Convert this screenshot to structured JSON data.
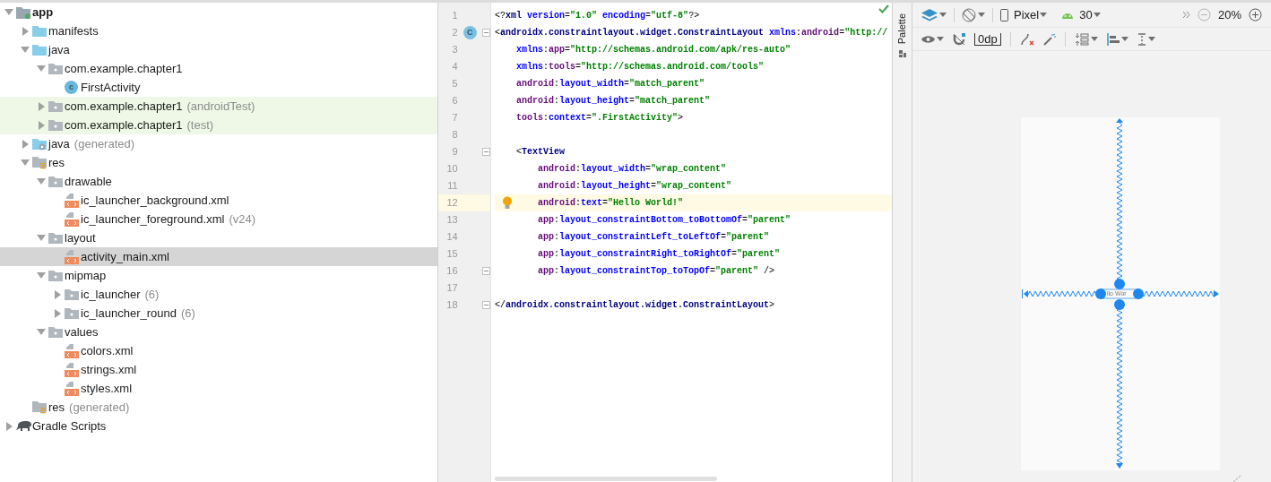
{
  "project_tree": [
    {
      "label": "app",
      "kind": "module",
      "expanded": true,
      "selected": false,
      "test_source": false,
      "children": [
        {
          "label": "manifests",
          "kind": "folder",
          "expanded": false,
          "selected": false,
          "test_source": false
        },
        {
          "label": "java",
          "kind": "folder",
          "expanded": true,
          "selected": false,
          "test_source": false,
          "children": [
            {
              "label": "com.example.chapter1",
              "kind": "package",
              "expanded": true,
              "selected": false,
              "test_source": false,
              "children": [
                {
                  "label": "FirstActivity",
                  "kind": "class",
                  "badge": "c",
                  "selected": false,
                  "test_source": false
                }
              ]
            },
            {
              "label": "com.example.chapter1",
              "suffix": "(androidTest)",
              "kind": "package",
              "expanded": false,
              "selected": false,
              "test_source": true
            },
            {
              "label": "com.example.chapter1",
              "suffix": "(test)",
              "kind": "package",
              "expanded": false,
              "selected": false,
              "test_source": true
            }
          ]
        },
        {
          "label": "java",
          "suffix": "(generated)",
          "kind": "generated",
          "expanded": false,
          "selected": false,
          "test_source": false
        },
        {
          "label": "res",
          "kind": "res",
          "expanded": true,
          "selected": false,
          "test_source": false,
          "children": [
            {
              "label": "drawable",
              "kind": "package",
              "expanded": true,
              "selected": false,
              "test_source": false,
              "children": [
                {
                  "label": "ic_launcher_background.xml",
                  "kind": "xml",
                  "selected": false,
                  "test_source": false
                },
                {
                  "label": "ic_launcher_foreground.xml",
                  "suffix": "(v24)",
                  "kind": "xml",
                  "selected": false,
                  "test_source": false
                }
              ]
            },
            {
              "label": "layout",
              "kind": "package",
              "expanded": true,
              "selected": false,
              "test_source": false,
              "children": [
                {
                  "label": "activity_main.xml",
                  "kind": "xml",
                  "selected": true,
                  "test_source": false
                }
              ]
            },
            {
              "label": "mipmap",
              "kind": "package",
              "expanded": true,
              "selected": false,
              "test_source": false,
              "children": [
                {
                  "label": "ic_launcher",
                  "suffix": "(6)",
                  "kind": "package",
                  "expanded": false,
                  "selected": false,
                  "test_source": false
                },
                {
                  "label": "ic_launcher_round",
                  "suffix": "(6)",
                  "kind": "package",
                  "expanded": false,
                  "selected": false,
                  "test_source": false
                }
              ]
            },
            {
              "label": "values",
              "kind": "package",
              "expanded": true,
              "selected": false,
              "test_source": false,
              "children": [
                {
                  "label": "colors.xml",
                  "kind": "xml",
                  "selected": false,
                  "test_source": false
                },
                {
                  "label": "strings.xml",
                  "kind": "xml",
                  "selected": false,
                  "test_source": false
                },
                {
                  "label": "styles.xml",
                  "kind": "xml",
                  "selected": false,
                  "test_source": false
                }
              ]
            }
          ]
        },
        {
          "label": "res",
          "suffix": "(generated)",
          "kind": "res",
          "selected": false,
          "test_source": false
        }
      ]
    },
    {
      "label": "Gradle Scripts",
      "kind": "gradle",
      "expanded": false,
      "selected": false,
      "test_source": false
    }
  ],
  "editor": {
    "lines": [
      {
        "number": "1",
        "fold": false,
        "current": false,
        "bulb": false,
        "tokens": [
          {
            "kind": "punct",
            "text": "<?"
          },
          {
            "kind": "tag",
            "text": "xml"
          },
          {
            "kind": "attr",
            "text": " version"
          },
          {
            "kind": "punct",
            "text": "="
          },
          {
            "kind": "value",
            "text": "\"1.0\""
          },
          {
            "kind": "attr",
            "text": " encoding"
          },
          {
            "kind": "punct",
            "text": "="
          },
          {
            "kind": "value",
            "text": "\"utf-8\""
          },
          {
            "kind": "punct",
            "text": "?>"
          }
        ]
      },
      {
        "number": "2",
        "fold": true,
        "current": false,
        "bulb": false,
        "gutter_badge": "C",
        "tokens": [
          {
            "kind": "punct",
            "text": "<"
          },
          {
            "kind": "tag",
            "text": "androidx.constraintlayout.widget.ConstraintLayout"
          },
          {
            "kind": "attr",
            "text": " xmlns"
          },
          {
            "kind": "punct",
            "text": ":"
          },
          {
            "kind": "ns",
            "text": "android"
          },
          {
            "kind": "punct",
            "text": "="
          },
          {
            "kind": "value",
            "text": "\"http://"
          }
        ]
      },
      {
        "number": "3",
        "fold": false,
        "current": false,
        "bulb": false,
        "tokens": [
          {
            "kind": "attr",
            "text": "    xmlns"
          },
          {
            "kind": "punct",
            "text": ":"
          },
          {
            "kind": "ns",
            "text": "app"
          },
          {
            "kind": "punct",
            "text": "="
          },
          {
            "kind": "value",
            "text": "\"http://schemas.android.com/apk/res-auto\""
          }
        ]
      },
      {
        "number": "4",
        "fold": false,
        "current": false,
        "bulb": false,
        "tokens": [
          {
            "kind": "attr",
            "text": "    xmlns"
          },
          {
            "kind": "punct",
            "text": ":"
          },
          {
            "kind": "ns",
            "text": "tools"
          },
          {
            "kind": "punct",
            "text": "="
          },
          {
            "kind": "value",
            "text": "\"http://schemas.android.com/tools\""
          }
        ]
      },
      {
        "number": "5",
        "fold": false,
        "current": false,
        "bulb": false,
        "tokens": [
          {
            "kind": "ns",
            "text": "    android"
          },
          {
            "kind": "punct",
            "text": ":"
          },
          {
            "kind": "attr",
            "text": "layout_width"
          },
          {
            "kind": "punct",
            "text": "="
          },
          {
            "kind": "value",
            "text": "\"match_parent\""
          }
        ]
      },
      {
        "number": "6",
        "fold": false,
        "current": false,
        "bulb": false,
        "tokens": [
          {
            "kind": "ns",
            "text": "    android"
          },
          {
            "kind": "punct",
            "text": ":"
          },
          {
            "kind": "attr",
            "text": "layout_height"
          },
          {
            "kind": "punct",
            "text": "="
          },
          {
            "kind": "value",
            "text": "\"match_parent\""
          }
        ]
      },
      {
        "number": "7",
        "fold": false,
        "current": false,
        "bulb": false,
        "tokens": [
          {
            "kind": "ns",
            "text": "    tools"
          },
          {
            "kind": "punct",
            "text": ":"
          },
          {
            "kind": "attr",
            "text": "context"
          },
          {
            "kind": "punct",
            "text": "="
          },
          {
            "kind": "value",
            "text": "\".FirstActivity\""
          },
          {
            "kind": "punct",
            "text": ">"
          }
        ]
      },
      {
        "number": "8",
        "fold": false,
        "current": false,
        "bulb": false
      },
      {
        "number": "9",
        "fold": true,
        "current": false,
        "bulb": false,
        "tokens": [
          {
            "kind": "punct",
            "text": "    <"
          },
          {
            "kind": "tag",
            "text": "TextView"
          }
        ]
      },
      {
        "number": "10",
        "fold": false,
        "current": false,
        "bulb": false,
        "tokens": [
          {
            "kind": "ns",
            "text": "        android"
          },
          {
            "kind": "punct",
            "text": ":"
          },
          {
            "kind": "attr",
            "text": "layout_width"
          },
          {
            "kind": "punct",
            "text": "="
          },
          {
            "kind": "value",
            "text": "\"wrap_content\""
          }
        ]
      },
      {
        "number": "11",
        "fold": false,
        "current": false,
        "bulb": false,
        "tokens": [
          {
            "kind": "ns",
            "text": "        android"
          },
          {
            "kind": "punct",
            "text": ":"
          },
          {
            "kind": "attr",
            "text": "layout_height"
          },
          {
            "kind": "punct",
            "text": "="
          },
          {
            "kind": "value",
            "text": "\"wrap_content\""
          }
        ]
      },
      {
        "number": "12",
        "fold": false,
        "current": true,
        "bulb": true,
        "tokens": [
          {
            "kind": "ns",
            "text": "        android"
          },
          {
            "kind": "punct",
            "text": ":"
          },
          {
            "kind": "attr",
            "text": "text"
          },
          {
            "kind": "punct",
            "text": "="
          },
          {
            "kind": "value",
            "text": "\"Hello World!\""
          }
        ]
      },
      {
        "number": "13",
        "fold": false,
        "current": false,
        "bulb": false,
        "tokens": [
          {
            "kind": "ns",
            "text": "        app"
          },
          {
            "kind": "punct",
            "text": ":"
          },
          {
            "kind": "attr",
            "text": "layout_constraintBottom_toBottomOf"
          },
          {
            "kind": "punct",
            "text": "="
          },
          {
            "kind": "value",
            "text": "\"parent\""
          }
        ]
      },
      {
        "number": "14",
        "fold": false,
        "current": false,
        "bulb": false,
        "tokens": [
          {
            "kind": "ns",
            "text": "        app"
          },
          {
            "kind": "punct",
            "text": ":"
          },
          {
            "kind": "attr",
            "text": "layout_constraintLeft_toLeftOf"
          },
          {
            "kind": "punct",
            "text": "="
          },
          {
            "kind": "value",
            "text": "\"parent\""
          }
        ]
      },
      {
        "number": "15",
        "fold": false,
        "current": false,
        "bulb": false,
        "tokens": [
          {
            "kind": "ns",
            "text": "        app"
          },
          {
            "kind": "punct",
            "text": ":"
          },
          {
            "kind": "attr",
            "text": "layout_constraintRight_toRightOf"
          },
          {
            "kind": "punct",
            "text": "="
          },
          {
            "kind": "value",
            "text": "\"parent\""
          }
        ]
      },
      {
        "number": "16",
        "fold": true,
        "current": false,
        "bulb": false,
        "tokens": [
          {
            "kind": "ns",
            "text": "        app"
          },
          {
            "kind": "punct",
            "text": ":"
          },
          {
            "kind": "attr",
            "text": "layout_constraintTop_toTopOf"
          },
          {
            "kind": "punct",
            "text": "="
          },
          {
            "kind": "value",
            "text": "\"parent\""
          },
          {
            "kind": "punct",
            "text": " />"
          }
        ]
      },
      {
        "number": "17",
        "fold": false,
        "current": false,
        "bulb": false
      },
      {
        "number": "18",
        "fold": true,
        "current": false,
        "bulb": false,
        "tokens": [
          {
            "kind": "punct",
            "text": "</"
          },
          {
            "kind": "tag",
            "text": "androidx.constraintlayout.widget.ConstraintLayout"
          },
          {
            "kind": "punct",
            "text": ">"
          }
        ]
      }
    ]
  },
  "palette_tab": {
    "label": "Palette"
  },
  "design_toolbar": {
    "device": "Pixel",
    "api": "30",
    "zoom": "20%",
    "margin": "0dp"
  },
  "design": {
    "textview_text": "llo Wor"
  }
}
